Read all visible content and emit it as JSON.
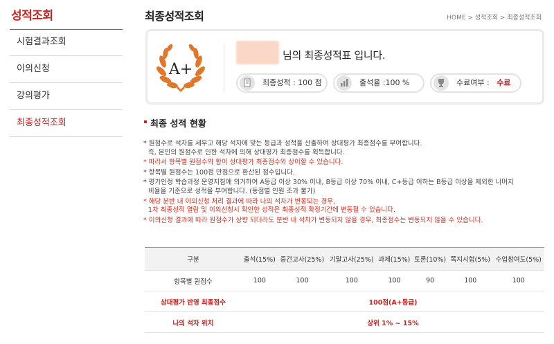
{
  "sidebar": {
    "title": "성적조회",
    "items": [
      {
        "label": "시험결과조회"
      },
      {
        "label": "이의신청"
      },
      {
        "label": "강의평가"
      },
      {
        "label": "최종성적조회"
      }
    ]
  },
  "header": {
    "title": "최종성적조회",
    "breadcrumb": [
      "HOME",
      ">",
      "성적조회",
      ">",
      "최종성적조회"
    ]
  },
  "summary": {
    "grade_badge": "A+",
    "message": "님의 최종성적표 입니다.",
    "final_score": "최종성적 : 100 점",
    "attendance": "출석율 :100 %",
    "completion_label": "수료여부 :",
    "completion_value": "수료"
  },
  "section_title": "최종 성적 현황",
  "notes": [
    {
      "text": "* 원점수로 석차를 세우고 해당 석차에 맞는 등급과 성적을 산출하여 상대평가 최종점수를 부여합니다.",
      "red": false
    },
    {
      "text": "즉, 본인의 원점수로 인한 석차에 의해 상대평가 최종점수를 획득합니다.",
      "red": false
    },
    {
      "text": "* 따라서 항목별 원점수의 합이 상대평가 최종점수와 상이할 수 있습니다.",
      "red": true
    },
    {
      "text": "* 항목별 원점수는 100점 만점으로 환산된 점수입니다.",
      "red": false
    },
    {
      "text": "* 평가인정 학습과정 운영지침에 의거하여 A등급 이상 30% 이내, B등급 이상 70% 이내, C+등급 이하는 B등급 이상을 제외한 나머지",
      "red": false
    },
    {
      "text": "비율을 기준으로 성적을 부여합니다. (동점별 인원 조과 불가)",
      "red": false
    },
    {
      "text": "* 해당 분반 내 이의신청 처리 결과에 따라 나의 석차가 변동되는 경우,",
      "red": true
    },
    {
      "text": "1차 최종성적 열람 및 이의신청시 확인한 성적은 최종성적 확정기간에 변동될 수 있습니다.",
      "red": true
    },
    {
      "text": "* 이의신청 결과에 따라 원점수가 상향 되더라도 분반 내 석차가 변동되지 않을 경우, 최종점수는 변동되지 않을 수 있습니다.",
      "red": true
    }
  ],
  "table": {
    "headers": [
      "구분",
      "출석(15%)",
      "중간고사(25%)",
      "기말고사(25%)",
      "과제(15%)",
      "토론(10%)",
      "쪽지시험(5%)",
      "수업참여도(5%)"
    ],
    "row_scores": {
      "label": "항목별 원점수",
      "values": [
        "100",
        "100",
        "100",
        "100",
        "90",
        "100",
        "100"
      ]
    },
    "row_relative": {
      "label": "상대평가 반영 최종점수",
      "value": "100점(A+등급)"
    },
    "row_rank": {
      "label": "나의 석차 위치",
      "value": "상위 1% ~ 15%"
    }
  },
  "colors": {
    "accent": "#c8211e",
    "laurel": "#e0772a"
  }
}
